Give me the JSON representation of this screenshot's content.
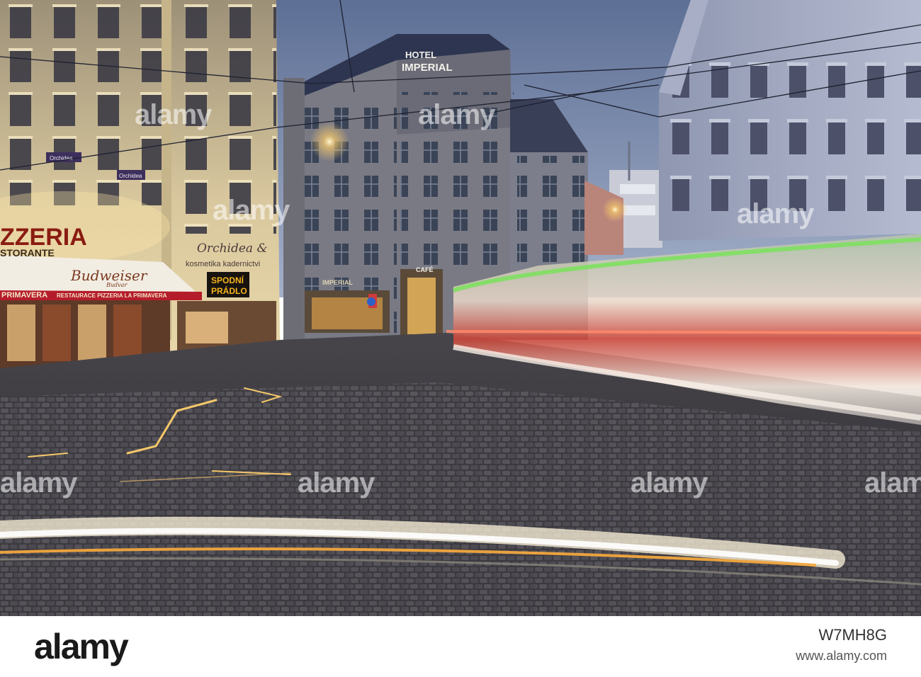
{
  "photo": {
    "hotel_sign_top": "HOTEL",
    "hotel_sign_main": "IMPERIAL",
    "pizzeria_sign": "ZZERIA",
    "ristorante_sign": "STORANTE",
    "awning_script": "Budweiser",
    "awning_sub": "Budvar",
    "primavera_left": "PRIMAVERA",
    "restaurace_sign": "RESTAURACE PIZZERIA LA PRIMAVERA",
    "orchidea_line1": "Orchidea &",
    "orchidea_line2": "kosmetika kadernictvi",
    "spodni_line1": "SPODNÍ",
    "spodni_line2": "PRÁDLO",
    "cafe_sign": "CAFÉ",
    "facade_imperial": "IMPERIAL",
    "banner_orchidea": "Orchidea",
    "colors": {
      "sky_top": "#5d6f95",
      "sky_bottom": "#9eacc7",
      "warm_light": "#f6c86a",
      "tram_red": "#c8463a",
      "tram_green": "#7ee060"
    }
  },
  "watermarks": [
    "alamy",
    "alamy",
    "alamy",
    "alamy",
    "alamy",
    "alamy",
    "alamy",
    "alamy"
  ],
  "footer": {
    "logo": "alamy",
    "code": "W7MH8G",
    "url": "www.alamy.com"
  }
}
